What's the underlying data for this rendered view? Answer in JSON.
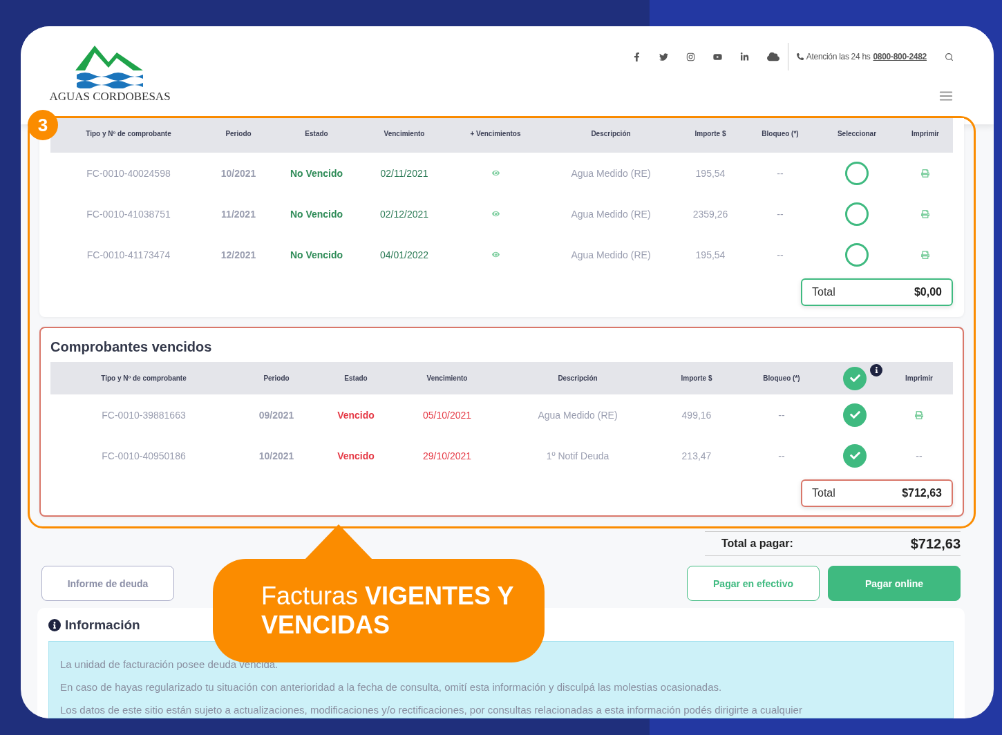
{
  "header": {
    "logo_text": "AGUAS CORDOBESAS",
    "contact": {
      "label": "Atención las 24 hs",
      "phone": "0800-800-2482"
    }
  },
  "step_badge": "3",
  "current": {
    "columns": [
      {
        "label": "Tipo y Nº de comprobante"
      },
      {
        "label": "Periodo"
      },
      {
        "label": "Estado"
      },
      {
        "label": "Vencimiento"
      },
      {
        "label": "+ Vencimientos"
      },
      {
        "label": "Descripción"
      },
      {
        "label": "Importe $"
      },
      {
        "label": "Bloqueo (*)"
      },
      {
        "label": "Seleccionar"
      },
      {
        "label": "Imprimir"
      }
    ],
    "rows": [
      {
        "number": "FC-0010-40024598",
        "period": "10/2021",
        "status": "No Vencido",
        "overdue": false,
        "due": "02/11/2021",
        "description": "Agua Medido (RE)",
        "amount": "195,54",
        "block": "--",
        "selected": false,
        "print": {
          "kind": "icon"
        }
      },
      {
        "number": "FC-0010-41038751",
        "period": "11/2021",
        "status": "No Vencido",
        "overdue": false,
        "due": "02/12/2021",
        "description": "Agua Medido (RE)",
        "amount": "2359,26",
        "block": "--",
        "selected": false,
        "print": {
          "kind": "icon"
        }
      },
      {
        "number": "FC-0010-41173474",
        "period": "12/2021",
        "status": "No Vencido",
        "overdue": false,
        "due": "04/01/2022",
        "description": "Agua Medido (RE)",
        "amount": "195,54",
        "block": "--",
        "selected": false,
        "print": {
          "kind": "icon"
        }
      }
    ],
    "total": {
      "label": "Total",
      "value": "$0,00"
    }
  },
  "overdue": {
    "title": "Comprobantes vencidos",
    "columns": [
      {
        "label": "Tipo y Nº de comprobante"
      },
      {
        "label": "Periodo"
      },
      {
        "label": "Estado"
      },
      {
        "label": "Vencimiento"
      },
      {
        "label": "Descripción"
      },
      {
        "label": "Importe $"
      },
      {
        "label": "Bloqueo (*)"
      },
      {
        "kind": "select_all",
        "selected": true
      },
      {
        "label": "Imprimir"
      }
    ],
    "rows": [
      {
        "number": "FC-0010-39881663",
        "period": "09/2021",
        "status": "Vencido",
        "overdue": true,
        "due": "05/10/2021",
        "description": "Agua Medido (RE)",
        "amount": "499,16",
        "block": "--",
        "selected": true,
        "print": {
          "kind": "icon"
        }
      },
      {
        "number": "FC-0010-40950186",
        "period": "10/2021",
        "status": "Vencido",
        "overdue": true,
        "due": "29/10/2021",
        "description": "1º Notif Deuda",
        "amount": "213,47",
        "block": "--",
        "selected": true,
        "print": {
          "kind": "text",
          "text": "--"
        }
      }
    ],
    "total": {
      "label": "Total",
      "value": "$712,63"
    }
  },
  "grand_total": {
    "label": "Total a pagar:",
    "value": "$712,63"
  },
  "buttons": [
    {
      "label": "Informe de deuda",
      "kind": "outline"
    },
    {
      "label": "Pagar en efectivo",
      "kind": "outline_green"
    },
    {
      "label": "Pagar online",
      "kind": "primary"
    }
  ],
  "info": {
    "title": "Información",
    "lines": [
      "La unidad de facturación posee deuda vencida.",
      "En caso de hayas regularizado tu situación con anterioridad a la fecha de consulta, omití esta información y disculpá las molestias ocasionadas.",
      "Los datos de este sitio están sujeto a actualizaciones, modificaciones y/o rectificaciones, por consultas relacionadas a esta información podés dirigirte a cualquier"
    ]
  },
  "callout": "Facturas **VIGENTES Y VENCIDAS**"
}
